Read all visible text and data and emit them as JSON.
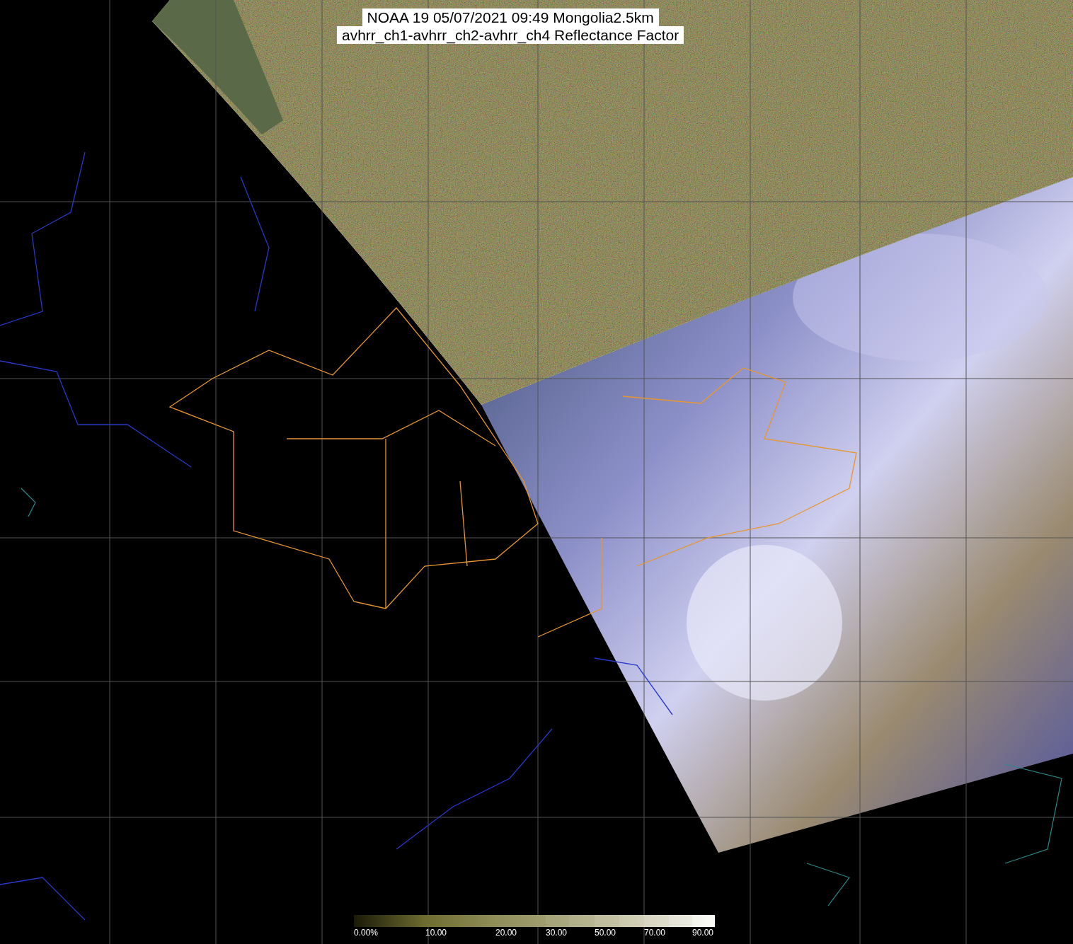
{
  "title": {
    "lines": [
      "NOAA 19 05/07/2021 09:49 Mongolia2.5km",
      "avhrr_ch1-avhrr_ch2-avhrr_ch4 Reflectance Factor"
    ]
  },
  "colorbar": {
    "labels": [
      "0.00%",
      "10.00",
      "20.00",
      "30.00",
      "50.00",
      "70.00",
      "90.00"
    ]
  }
}
